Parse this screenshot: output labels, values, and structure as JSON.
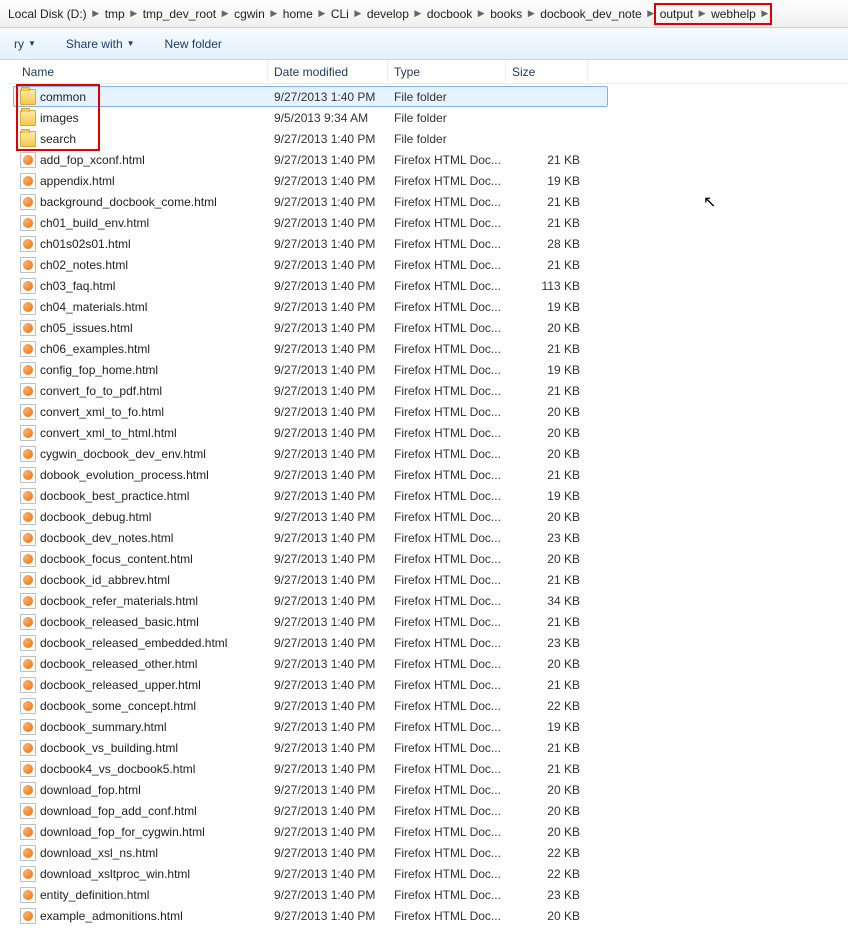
{
  "breadcrumb": [
    "Local Disk (D:)",
    "tmp",
    "tmp_dev_root",
    "cgwin",
    "home",
    "CLi",
    "develop",
    "docbook",
    "books",
    "docbook_dev_note",
    "output",
    "webhelp"
  ],
  "breadcrumb_highlight_start_index": 10,
  "toolbar": {
    "library_suffix": "ry",
    "share": "Share with",
    "new_folder": "New folder"
  },
  "columns": {
    "name": "Name",
    "date": "Date modified",
    "type": "Type",
    "size": "Size"
  },
  "type_labels": {
    "folder": "File folder",
    "html": "Firefox HTML Doc..."
  },
  "highlighted_folders": [
    {
      "name": "common",
      "date": "9/27/2013 1:40 PM",
      "selected": true
    },
    {
      "name": "images",
      "date": "9/5/2013 9:34 AM",
      "selected": false
    },
    {
      "name": "search",
      "date": "9/27/2013 1:40 PM",
      "selected": false
    }
  ],
  "files": [
    {
      "name": "add_fop_xconf.html",
      "date": "9/27/2013 1:40 PM",
      "size": "21 KB"
    },
    {
      "name": "appendix.html",
      "date": "9/27/2013 1:40 PM",
      "size": "19 KB"
    },
    {
      "name": "background_docbook_come.html",
      "date": "9/27/2013 1:40 PM",
      "size": "21 KB"
    },
    {
      "name": "ch01_build_env.html",
      "date": "9/27/2013 1:40 PM",
      "size": "21 KB"
    },
    {
      "name": "ch01s02s01.html",
      "date": "9/27/2013 1:40 PM",
      "size": "28 KB"
    },
    {
      "name": "ch02_notes.html",
      "date": "9/27/2013 1:40 PM",
      "size": "21 KB"
    },
    {
      "name": "ch03_faq.html",
      "date": "9/27/2013 1:40 PM",
      "size": "113 KB"
    },
    {
      "name": "ch04_materials.html",
      "date": "9/27/2013 1:40 PM",
      "size": "19 KB"
    },
    {
      "name": "ch05_issues.html",
      "date": "9/27/2013 1:40 PM",
      "size": "20 KB"
    },
    {
      "name": "ch06_examples.html",
      "date": "9/27/2013 1:40 PM",
      "size": "21 KB"
    },
    {
      "name": "config_fop_home.html",
      "date": "9/27/2013 1:40 PM",
      "size": "19 KB"
    },
    {
      "name": "convert_fo_to_pdf.html",
      "date": "9/27/2013 1:40 PM",
      "size": "21 KB"
    },
    {
      "name": "convert_xml_to_fo.html",
      "date": "9/27/2013 1:40 PM",
      "size": "20 KB"
    },
    {
      "name": "convert_xml_to_html.html",
      "date": "9/27/2013 1:40 PM",
      "size": "20 KB"
    },
    {
      "name": "cygwin_docbook_dev_env.html",
      "date": "9/27/2013 1:40 PM",
      "size": "20 KB"
    },
    {
      "name": "dobook_evolution_process.html",
      "date": "9/27/2013 1:40 PM",
      "size": "21 KB"
    },
    {
      "name": "docbook_best_practice.html",
      "date": "9/27/2013 1:40 PM",
      "size": "19 KB"
    },
    {
      "name": "docbook_debug.html",
      "date": "9/27/2013 1:40 PM",
      "size": "20 KB"
    },
    {
      "name": "docbook_dev_notes.html",
      "date": "9/27/2013 1:40 PM",
      "size": "23 KB"
    },
    {
      "name": "docbook_focus_content.html",
      "date": "9/27/2013 1:40 PM",
      "size": "20 KB"
    },
    {
      "name": "docbook_id_abbrev.html",
      "date": "9/27/2013 1:40 PM",
      "size": "21 KB"
    },
    {
      "name": "docbook_refer_materials.html",
      "date": "9/27/2013 1:40 PM",
      "size": "34 KB"
    },
    {
      "name": "docbook_released_basic.html",
      "date": "9/27/2013 1:40 PM",
      "size": "21 KB"
    },
    {
      "name": "docbook_released_embedded.html",
      "date": "9/27/2013 1:40 PM",
      "size": "23 KB"
    },
    {
      "name": "docbook_released_other.html",
      "date": "9/27/2013 1:40 PM",
      "size": "20 KB"
    },
    {
      "name": "docbook_released_upper.html",
      "date": "9/27/2013 1:40 PM",
      "size": "21 KB"
    },
    {
      "name": "docbook_some_concept.html",
      "date": "9/27/2013 1:40 PM",
      "size": "22 KB"
    },
    {
      "name": "docbook_summary.html",
      "date": "9/27/2013 1:40 PM",
      "size": "19 KB"
    },
    {
      "name": "docbook_vs_building.html",
      "date": "9/27/2013 1:40 PM",
      "size": "21 KB"
    },
    {
      "name": "docbook4_vs_docbook5.html",
      "date": "9/27/2013 1:40 PM",
      "size": "21 KB"
    },
    {
      "name": "download_fop.html",
      "date": "9/27/2013 1:40 PM",
      "size": "20 KB"
    },
    {
      "name": "download_fop_add_conf.html",
      "date": "9/27/2013 1:40 PM",
      "size": "20 KB"
    },
    {
      "name": "download_fop_for_cygwin.html",
      "date": "9/27/2013 1:40 PM",
      "size": "20 KB"
    },
    {
      "name": "download_xsl_ns.html",
      "date": "9/27/2013 1:40 PM",
      "size": "22 KB"
    },
    {
      "name": "download_xsltproc_win.html",
      "date": "9/27/2013 1:40 PM",
      "size": "22 KB"
    },
    {
      "name": "entity_definition.html",
      "date": "9/27/2013 1:40 PM",
      "size": "23 KB"
    },
    {
      "name": "example_admonitions.html",
      "date": "9/27/2013 1:40 PM",
      "size": "20 KB"
    }
  ]
}
